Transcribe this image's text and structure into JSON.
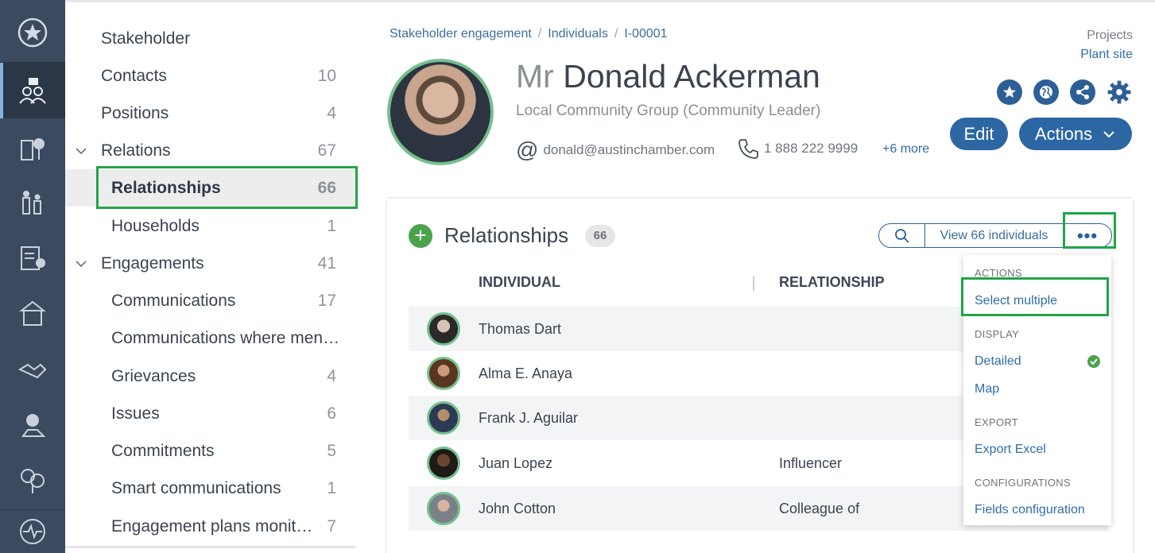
{
  "rail": {
    "icons": [
      "star-icon",
      "stakeholder-icon",
      "buildings-icon",
      "people-icon",
      "checklist-icon",
      "houses-icon",
      "handshake-icon",
      "location-icon",
      "environment-icon",
      "activity-icon"
    ]
  },
  "nav": {
    "items": [
      {
        "label": "Stakeholder",
        "count": ""
      },
      {
        "label": "Contacts",
        "count": "10"
      },
      {
        "label": "Positions",
        "count": "4"
      },
      {
        "label": "Relations",
        "count": "67"
      },
      {
        "label": "Relationships",
        "count": "66"
      },
      {
        "label": "Households",
        "count": "1"
      },
      {
        "label": "Engagements",
        "count": "41"
      },
      {
        "label": "Communications",
        "count": "17"
      },
      {
        "label": "Communications where men…",
        "count": ""
      },
      {
        "label": "Grievances",
        "count": "4"
      },
      {
        "label": "Issues",
        "count": "6"
      },
      {
        "label": "Commitments",
        "count": "5"
      },
      {
        "label": "Smart communications",
        "count": "1"
      },
      {
        "label": "Engagement plans monit…",
        "count": "7"
      }
    ]
  },
  "breadcrumb": [
    "Stakeholder engagement",
    "Individuals",
    "I-00001"
  ],
  "projects": {
    "label": "Projects",
    "value": "Plant site"
  },
  "profile": {
    "title": "Mr",
    "name": "Donald Ackerman",
    "subtitle": "Local Community Group (Community Leader)",
    "email_icon": "@",
    "email": "donald@austinchamber.com",
    "phone": "1 888 222 9999",
    "more": "+6 more"
  },
  "buttons": {
    "edit": "Edit",
    "actions": "Actions"
  },
  "card": {
    "title": "Relationships",
    "count": "66",
    "view_label": "View 66 individuals",
    "more_label": "•••",
    "columns": [
      "INDIVIDUAL",
      "RELATIONSHIP"
    ],
    "rows": [
      {
        "name": "Thomas Dart",
        "relationship": ""
      },
      {
        "name": "Alma E. Anaya",
        "relationship": ""
      },
      {
        "name": "Frank J. Aguilar",
        "relationship": ""
      },
      {
        "name": "Juan Lopez",
        "relationship": "Influencer"
      },
      {
        "name": "John Cotton",
        "relationship": "Colleague of"
      }
    ]
  },
  "dropdown": {
    "actions_header": "ACTIONS",
    "select_multiple": "Select multiple",
    "display_header": "DISPLAY",
    "detailed": "Detailed",
    "map": "Map",
    "export_header": "EXPORT",
    "export_excel": "Export Excel",
    "config_header": "CONFIGURATIONS",
    "fields_config": "Fields configuration"
  },
  "colors": {
    "accent": "#2c66a3",
    "highlight": "#22a449",
    "rail": "#3c4a60"
  }
}
